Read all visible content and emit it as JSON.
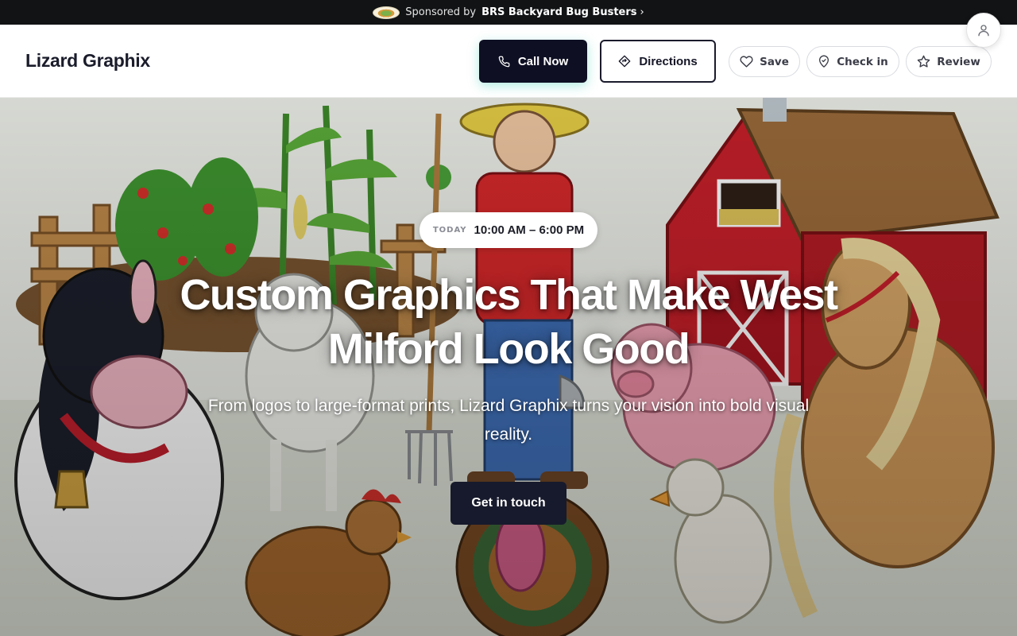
{
  "sponsor": {
    "prefix": "Sponsored by",
    "brand": "BRS Backyard Bug Busters",
    "chevron": "›",
    "logo_icon": "sponsor-logo-badge"
  },
  "header": {
    "title": "Lizard Graphix",
    "call_label": "Call Now",
    "directions_label": "Directions",
    "save_label": "Save",
    "checkin_label": "Check in",
    "review_label": "Review",
    "icons": [
      "phone-icon",
      "directions-icon",
      "heart-icon",
      "location-pin-icon",
      "star-icon",
      "user-icon"
    ]
  },
  "hero": {
    "hours_label": "TODAY",
    "hours_value": "10:00 AM – 6:00 PM",
    "headline": "Custom Graphics That Make West Milford Look Good",
    "subhead": "From logos to large-format prints, Lizard Graphix turns your vision into bold visual reality.",
    "cta_label": "Get in touch",
    "background_image": "cartoon farm scene with farmer, barn, cow, sheep, pig, horse, chicken, turkey and duck"
  },
  "colors": {
    "sponsor_bar_bg": "#111315",
    "primary_button": "#0e0f23",
    "accent_glow": "#1ec8aa",
    "cta_bg": "#171a2c",
    "barn_red": "#c8202a"
  }
}
